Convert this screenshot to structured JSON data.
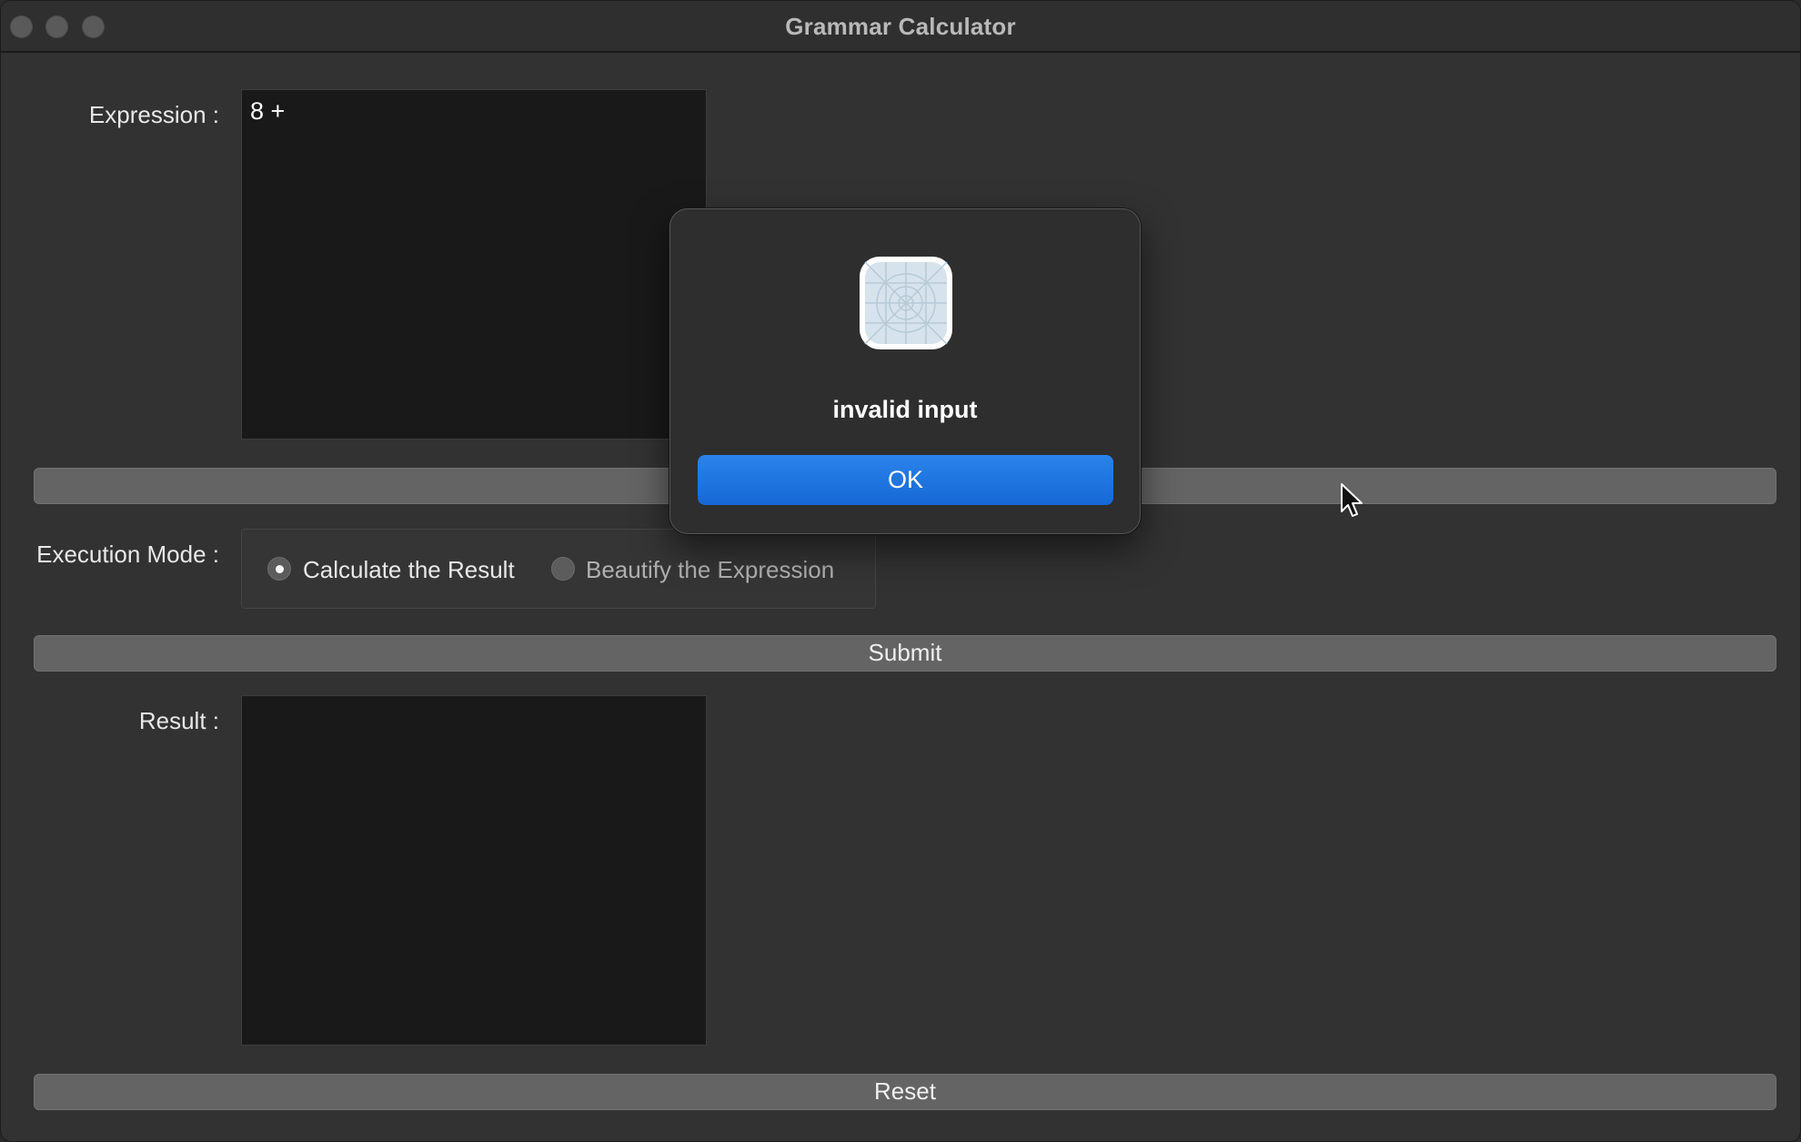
{
  "window": {
    "title": "Grammar Calculator",
    "controls": [
      "close-button",
      "minimize-button",
      "zoom-button"
    ]
  },
  "expression": {
    "label": "Expression :",
    "value": "8 +"
  },
  "execution_mode": {
    "label": "Execution Mode :",
    "options": [
      {
        "label": "Calculate the Result",
        "checked": true
      },
      {
        "label": "Beautify the Expression",
        "checked": false
      }
    ]
  },
  "buttons": {
    "blank_label": "",
    "submit_label": "Submit",
    "reset_label": "Reset"
  },
  "result": {
    "label": "Result :",
    "value": ""
  },
  "dialog": {
    "icon": "generic-app-icon",
    "message": "invalid input",
    "ok_label": "OK"
  },
  "colors": {
    "accent": "#1a6fdc",
    "window_bg": "#323232",
    "textarea_bg": "#191919"
  }
}
